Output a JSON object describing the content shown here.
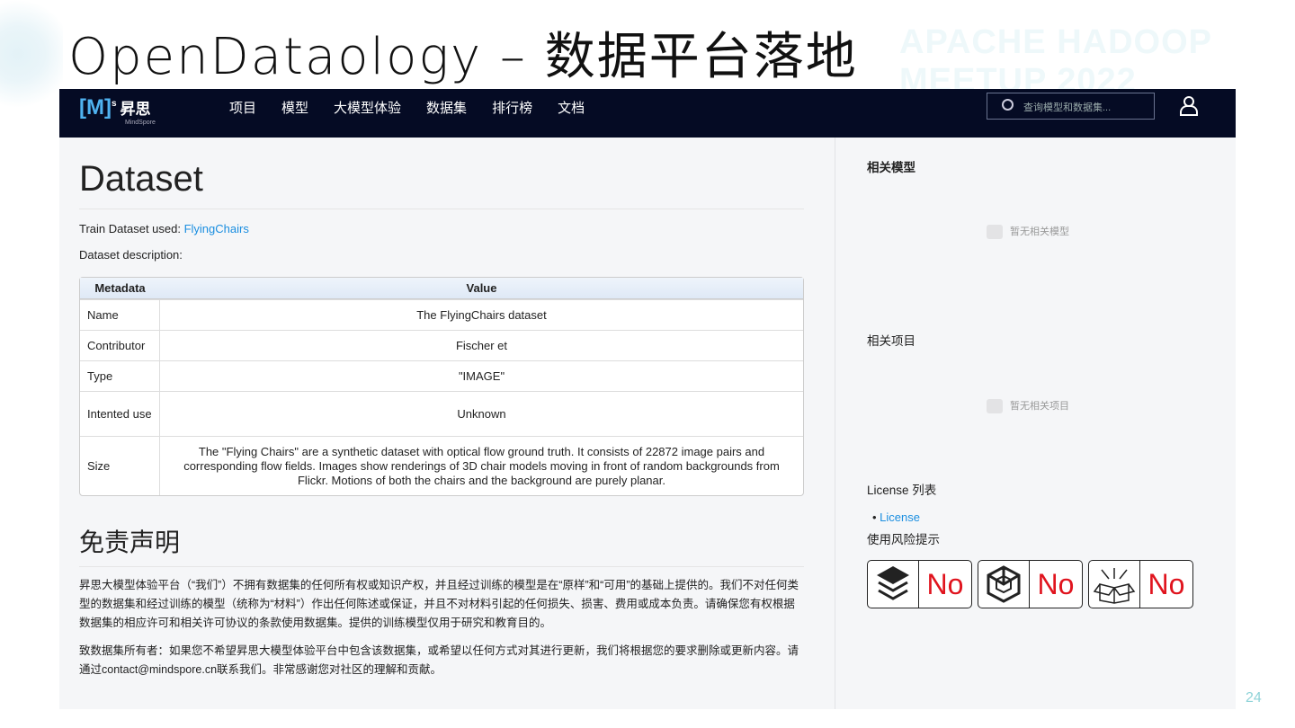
{
  "slide": {
    "title": "OpenDataology – 数据平台落地",
    "watermark": "APACHE HADOOP MEETUP 2022",
    "page_number": "24"
  },
  "nav": {
    "logo": "[M]",
    "logo_sup": "s",
    "logo_cn": "昇思",
    "logo_sub": "MindSpore",
    "items": [
      "项目",
      "模型",
      "大模型体验",
      "数据集",
      "排行榜",
      "文档"
    ],
    "search_placeholder": "查询模型和数据集..."
  },
  "main": {
    "title": "Dataset",
    "train_label": "Train Dataset used: ",
    "train_link": "FlyingChairs",
    "desc_label": "Dataset description:",
    "table": {
      "headers": [
        "Metadata",
        "Value"
      ],
      "rows": [
        [
          "Name",
          "The FlyingChairs dataset"
        ],
        [
          "Contributor",
          "Fischer et"
        ],
        [
          "Type",
          "\"IMAGE\""
        ],
        [
          "Intented use",
          "Unknown"
        ],
        [
          "Size",
          "The \"Flying Chairs\" are a synthetic dataset with optical flow ground truth. It consists of 22872 image pairs and corresponding flow fields. Images show renderings of 3D chair models moving in front of random backgrounds from Flickr. Motions of both the chairs and the background are purely planar."
        ]
      ]
    },
    "disclaimer_title": "免责声明",
    "disclaimer_1": "昇思大模型体验平台（“我们”）不拥有数据集的任何所有权或知识产权，并且经过训练的模型是在“原样”和“可用”的基础上提供的。我们不对任何类型的数据集和经过训练的模型（统称为“材料”）作出任何陈述或保证，并且不对材料引起的任何损失、损害、费用或成本负责。请确保您有权根据数据集的相应许可和相关许可协议的条款使用数据集。提供的训练模型仅用于研究和教育目的。",
    "disclaimer_2": "致数据集所有者：如果您不希望昇思大模型体验平台中包含该数据集，或希望以任何方式对其进行更新，我们将根据您的要求删除或更新内容。请通过contact@mindspore.cn联系我们。非常感谢您对社区的理解和贡献。"
  },
  "side": {
    "related_models": "相关模型",
    "no_models": "暂无相关模型",
    "related_projects": "相关项目",
    "no_projects": "暂无相关项目",
    "license_title": "License 列表",
    "license_link": "License",
    "risk_title": "使用风险提示",
    "badges": [
      "No",
      "No",
      "No"
    ]
  }
}
